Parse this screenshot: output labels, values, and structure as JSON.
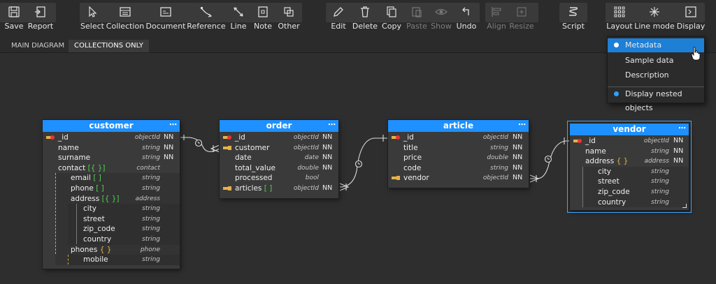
{
  "toolbar": {
    "buttons": [
      {
        "key": "save",
        "label": "Save",
        "icon": "save-icon"
      },
      {
        "key": "report",
        "label": "Report",
        "icon": "report-icon"
      },
      {
        "key": "select",
        "label": "Select",
        "icon": "cursor-icon"
      },
      {
        "key": "collection",
        "label": "Collection",
        "icon": "collection-icon"
      },
      {
        "key": "document",
        "label": "Document",
        "icon": "document-icon"
      },
      {
        "key": "reference",
        "label": "Reference",
        "icon": "reference-icon"
      },
      {
        "key": "line",
        "label": "Line",
        "icon": "line-icon"
      },
      {
        "key": "note",
        "label": "Note",
        "icon": "note-icon"
      },
      {
        "key": "other",
        "label": "Other",
        "icon": "other-icon"
      },
      {
        "key": "edit",
        "label": "Edit",
        "icon": "pencil-icon"
      },
      {
        "key": "delete",
        "label": "Delete",
        "icon": "trash-icon"
      },
      {
        "key": "copy",
        "label": "Copy",
        "icon": "copy-icon"
      },
      {
        "key": "paste",
        "label": "Paste",
        "icon": "paste-icon"
      },
      {
        "key": "show",
        "label": "Show",
        "icon": "eye-icon"
      },
      {
        "key": "undo",
        "label": "Undo",
        "icon": "undo-icon"
      },
      {
        "key": "align",
        "label": "Align",
        "icon": "align-icon"
      },
      {
        "key": "resize",
        "label": "Resize",
        "icon": "resize-icon"
      },
      {
        "key": "script",
        "label": "Script",
        "icon": "script-icon"
      },
      {
        "key": "layout",
        "label": "Layout",
        "icon": "layout-icon"
      },
      {
        "key": "linemode",
        "label": "Line mode",
        "icon": "line-mode-icon"
      },
      {
        "key": "display",
        "label": "Display",
        "icon": "display-icon"
      }
    ]
  },
  "tabs": {
    "main": "MAIN DIAGRAM",
    "collections": "COLLECTIONS ONLY"
  },
  "menu": {
    "metadata": "Metadata",
    "sample": "Sample data",
    "description": "Description",
    "nested": "Display nested objects"
  },
  "entities": {
    "customer": {
      "title": "customer",
      "fields": [
        {
          "name": "_id",
          "type": "objectId",
          "nn": "NN"
        },
        {
          "name": "name",
          "type": "string",
          "nn": "NN"
        },
        {
          "name": "surname",
          "type": "string",
          "nn": "NN"
        },
        {
          "name": "contact",
          "bracket": "[{ }]",
          "type": "contact",
          "nn": ""
        },
        {
          "name": "email",
          "bracket": "[ ]",
          "type": "string",
          "nn": ""
        },
        {
          "name": "phone",
          "bracket": "[ ]",
          "type": "string",
          "nn": ""
        },
        {
          "name": "address",
          "bracket": "[{ }]",
          "type": "address",
          "nn": ""
        },
        {
          "name": "city",
          "type": "string",
          "nn": ""
        },
        {
          "name": "street",
          "type": "string",
          "nn": ""
        },
        {
          "name": "zip_code",
          "type": "string",
          "nn": ""
        },
        {
          "name": "country",
          "type": "string",
          "nn": ""
        },
        {
          "name": "phones",
          "bracket": "{ }",
          "type": "phone",
          "nn": ""
        },
        {
          "name": "mobile",
          "type": "string",
          "nn": ""
        }
      ]
    },
    "order": {
      "title": "order",
      "fields": [
        {
          "name": "_id",
          "type": "objectId",
          "nn": "NN"
        },
        {
          "name": "customer",
          "type": "objectId",
          "nn": "NN"
        },
        {
          "name": "date",
          "type": "date",
          "nn": "NN"
        },
        {
          "name": "total_value",
          "type": "double",
          "nn": "NN"
        },
        {
          "name": "processed",
          "type": "bool",
          "nn": ""
        },
        {
          "name": "articles",
          "bracket": "[ ]",
          "type": "objectId",
          "nn": "NN"
        }
      ]
    },
    "article": {
      "title": "article",
      "fields": [
        {
          "name": "_id",
          "type": "objectId",
          "nn": "NN"
        },
        {
          "name": "title",
          "type": "string",
          "nn": "NN"
        },
        {
          "name": "price",
          "type": "double",
          "nn": "NN"
        },
        {
          "name": "code",
          "type": "string",
          "nn": "NN"
        },
        {
          "name": "vendor",
          "type": "objectId",
          "nn": "NN"
        }
      ]
    },
    "vendor": {
      "title": "vendor",
      "fields": [
        {
          "name": "_id",
          "type": "objectId",
          "nn": "NN"
        },
        {
          "name": "name",
          "type": "string",
          "nn": "NN"
        },
        {
          "name": "address",
          "bracket": "{ }",
          "type": "address",
          "nn": "NN"
        },
        {
          "name": "city",
          "type": "string",
          "nn": ""
        },
        {
          "name": "street",
          "type": "string",
          "nn": ""
        },
        {
          "name": "zip_code",
          "type": "string",
          "nn": ""
        },
        {
          "name": "country",
          "type": "string",
          "nn": ""
        }
      ]
    }
  },
  "colors": {
    "accent": "#1e90ff",
    "menu_active": "#1e7fd6",
    "bracket_array": "#4fd14f",
    "bracket_object": "#e8b04a"
  }
}
